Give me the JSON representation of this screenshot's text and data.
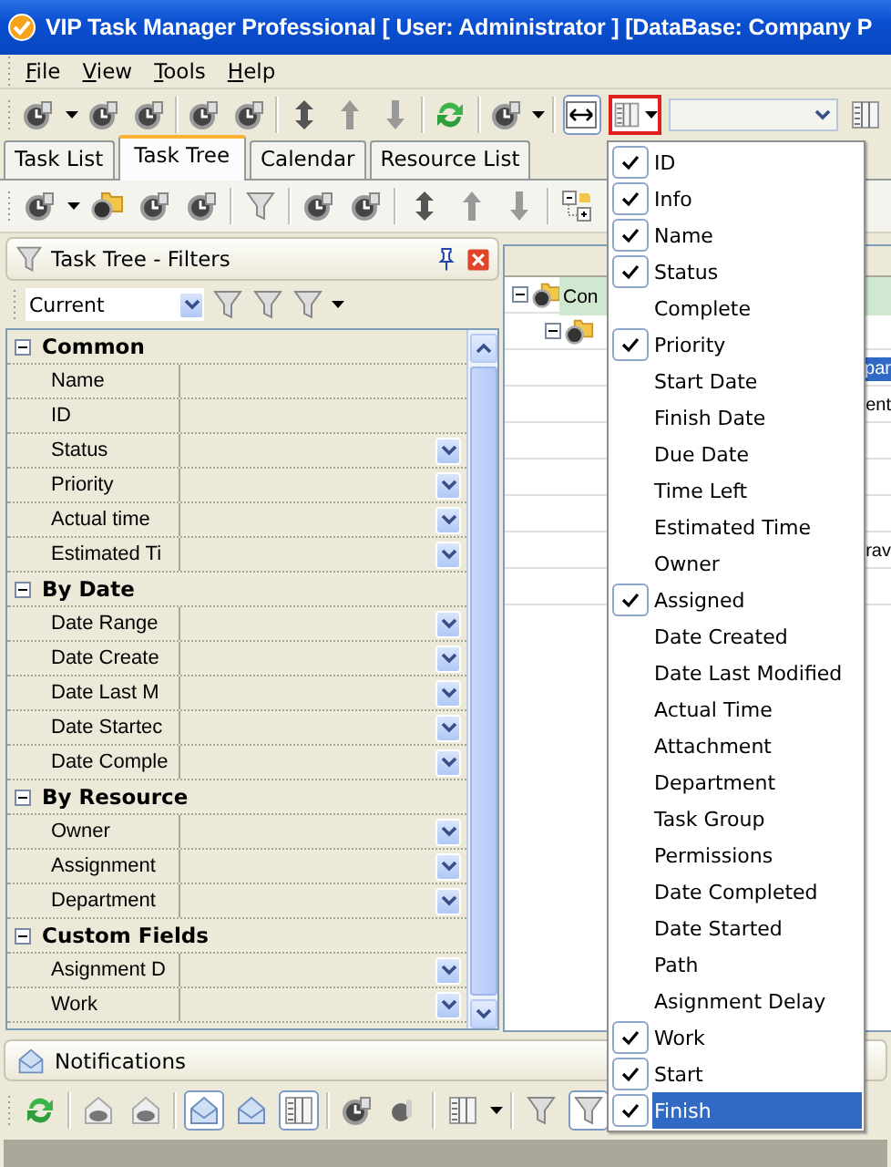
{
  "window": {
    "title": "VIP Task Manager Professional [ User: Administrator ] [DataBase: Company P"
  },
  "menu_bar": [
    "File",
    "View",
    "Tools",
    "Help"
  ],
  "toolbar": {
    "column_chooser_open": true
  },
  "tabs": [
    {
      "label": "Task List",
      "selected": false
    },
    {
      "label": "Task Tree",
      "selected": true
    },
    {
      "label": "Calendar",
      "selected": false
    },
    {
      "label": "Resource List",
      "selected": false
    }
  ],
  "filter_panel": {
    "title": "Task Tree - Filters",
    "preset": "Current",
    "sections": [
      {
        "label": "Common",
        "expanded": true,
        "rows": [
          {
            "label": "Name",
            "dropdown": false
          },
          {
            "label": "ID",
            "dropdown": false
          },
          {
            "label": "Status",
            "dropdown": true
          },
          {
            "label": "Priority",
            "dropdown": true
          },
          {
            "label": "Actual time",
            "dropdown": true
          },
          {
            "label": "Estimated Ti",
            "dropdown": true
          }
        ]
      },
      {
        "label": "By Date",
        "expanded": true,
        "rows": [
          {
            "label": "Date Range",
            "dropdown": true
          },
          {
            "label": "Date Create",
            "dropdown": true
          },
          {
            "label": "Date Last M",
            "dropdown": true
          },
          {
            "label": "Date Startec",
            "dropdown": true
          },
          {
            "label": "Date Comple",
            "dropdown": true
          }
        ]
      },
      {
        "label": "By Resource",
        "expanded": true,
        "rows": [
          {
            "label": "Owner",
            "dropdown": true
          },
          {
            "label": "Assignment",
            "dropdown": true
          },
          {
            "label": "Department",
            "dropdown": true
          }
        ]
      },
      {
        "label": "Custom Fields",
        "expanded": true,
        "rows": [
          {
            "label": "Asignment D",
            "dropdown": true
          },
          {
            "label": "Work",
            "dropdown": true
          }
        ]
      }
    ]
  },
  "tree": {
    "cells": [
      {
        "text": "Con",
        "kind": "group",
        "selected": false
      },
      {
        "text": "par",
        "kind": "task",
        "selected": true
      },
      {
        "text": "ent",
        "kind": "task",
        "selected": false
      },
      {
        "text": "rav",
        "kind": "task",
        "selected": false
      }
    ]
  },
  "column_menu": {
    "items": [
      {
        "label": "ID",
        "checked": true,
        "selected": false
      },
      {
        "label": "Info",
        "checked": true,
        "selected": false
      },
      {
        "label": "Name",
        "checked": true,
        "selected": false
      },
      {
        "label": "Status",
        "checked": true,
        "selected": false
      },
      {
        "label": "Complete",
        "checked": false,
        "selected": false
      },
      {
        "label": "Priority",
        "checked": true,
        "selected": false
      },
      {
        "label": "Start Date",
        "checked": false,
        "selected": false
      },
      {
        "label": "Finish Date",
        "checked": false,
        "selected": false
      },
      {
        "label": "Due Date",
        "checked": false,
        "selected": false
      },
      {
        "label": "Time Left",
        "checked": false,
        "selected": false
      },
      {
        "label": "Estimated Time",
        "checked": false,
        "selected": false
      },
      {
        "label": "Owner",
        "checked": false,
        "selected": false
      },
      {
        "label": "Assigned",
        "checked": true,
        "selected": false
      },
      {
        "label": "Date Created",
        "checked": false,
        "selected": false
      },
      {
        "label": "Date Last Modified",
        "checked": false,
        "selected": false
      },
      {
        "label": "Actual Time",
        "checked": false,
        "selected": false
      },
      {
        "label": "Attachment",
        "checked": false,
        "selected": false
      },
      {
        "label": "Department",
        "checked": false,
        "selected": false
      },
      {
        "label": "Task Group",
        "checked": false,
        "selected": false
      },
      {
        "label": "Permissions",
        "checked": false,
        "selected": false
      },
      {
        "label": "Date Completed",
        "checked": false,
        "selected": false
      },
      {
        "label": "Date Started",
        "checked": false,
        "selected": false
      },
      {
        "label": "Path",
        "checked": false,
        "selected": false
      },
      {
        "label": "Asignment Delay",
        "checked": false,
        "selected": false
      },
      {
        "label": "Work",
        "checked": true,
        "selected": false
      },
      {
        "label": "Start",
        "checked": true,
        "selected": false
      },
      {
        "label": "Finish",
        "checked": true,
        "selected": true
      }
    ]
  },
  "notifications": {
    "title": "Notifications",
    "tools": [
      {
        "pressed": false
      },
      {
        "pressed": false
      },
      {
        "pressed": false
      },
      {
        "pressed": true
      },
      {
        "pressed": false
      },
      {
        "pressed": true
      },
      {
        "pressed": false
      },
      {
        "pressed": false
      },
      {
        "pressed": false
      },
      {
        "pressed": false
      },
      {
        "pressed": true
      }
    ]
  }
}
